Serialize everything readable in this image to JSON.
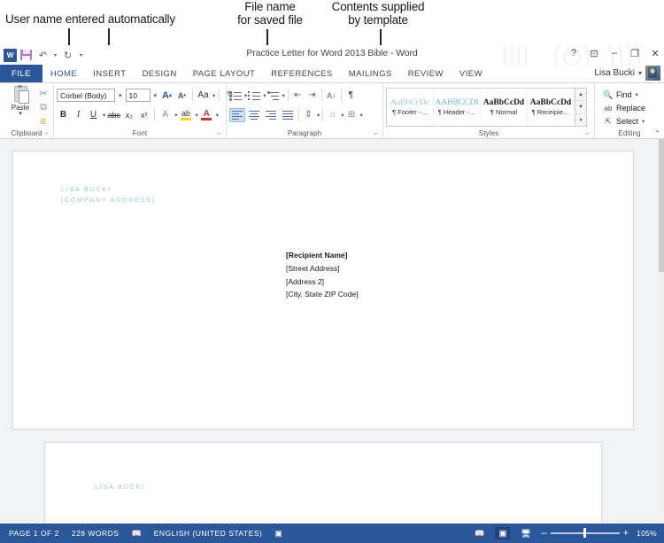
{
  "annotations": [
    {
      "id": "username",
      "text": "User name entered automatically"
    },
    {
      "id": "filename",
      "text": "File name\nfor saved file"
    },
    {
      "id": "contents",
      "text": "Contents supplied\nby template"
    }
  ],
  "window": {
    "title": "Practice Letter for Word 2013 Bible  -  Word",
    "quick_access": [
      {
        "name": "word-logo",
        "label": "W"
      },
      {
        "name": "save",
        "label": ""
      },
      {
        "name": "undo",
        "label": "↶"
      },
      {
        "name": "undo-dropdown",
        "label": "▾"
      },
      {
        "name": "redo",
        "label": "↻"
      },
      {
        "name": "customize-qat",
        "label": "▾"
      }
    ],
    "controls": [
      {
        "name": "help",
        "label": "?"
      },
      {
        "name": "ribbon-display-options",
        "label": "⊡"
      },
      {
        "name": "minimize",
        "label": "–"
      },
      {
        "name": "restore",
        "label": "❐"
      },
      {
        "name": "close",
        "label": "✕"
      }
    ],
    "account": {
      "name": "Lisa Bucki",
      "caret": "▾"
    }
  },
  "tabs": [
    {
      "label": "FILE",
      "state": "file"
    },
    {
      "label": "HOME",
      "state": "active"
    },
    {
      "label": "INSERT",
      "state": "normal"
    },
    {
      "label": "DESIGN",
      "state": "normal"
    },
    {
      "label": "PAGE LAYOUT",
      "state": "normal"
    },
    {
      "label": "REFERENCES",
      "state": "normal"
    },
    {
      "label": "MAILINGS",
      "state": "normal"
    },
    {
      "label": "REVIEW",
      "state": "normal"
    },
    {
      "label": "VIEW",
      "state": "normal"
    }
  ],
  "ribbon": {
    "collapse_label": "⌃",
    "clipboard": {
      "label": "Clipboard",
      "dialog_launcher": "⌐",
      "paste_label": "Paste",
      "paste_caret": "▾",
      "cut_label": "✂",
      "copy_label": "⧉",
      "format_painter_label": "⚟"
    },
    "font": {
      "label": "Font",
      "dialog_launcher": "⌐",
      "font_name": "Corbel (Body)",
      "font_size": "10",
      "grow_font": "A",
      "shrink_font": "A",
      "change_case": "Aa",
      "clear_formatting": "⌫",
      "bold": "B",
      "italic": "I",
      "underline": "U",
      "strikethrough": "abc",
      "subscript": "x₂",
      "superscript": "x²",
      "text_effects": "A",
      "highlight": "ab",
      "font_color": "A",
      "caret": "▾"
    },
    "paragraph": {
      "label": "Paragraph",
      "dialog_launcher": "⌐",
      "bullets": "bullets",
      "numbering": "numbering",
      "multilevel": "multilevel",
      "decrease_indent": "⇤",
      "increase_indent": "⇥",
      "sort": "↓",
      "show_marks": "¶",
      "align_left": "align-left",
      "align_center": "align-center",
      "align_right": "align-right",
      "justify": "justify",
      "line_spacing": "⇕",
      "shading": "▨",
      "borders": "⊞",
      "caret": "▾"
    },
    "styles": {
      "label": "Styles",
      "dialog_launcher": "⌐",
      "scroll_up": "▲",
      "scroll_down": "▼",
      "more": "▾",
      "items": [
        {
          "sample": "AaBbCcDc",
          "name": "¶ Footer -…",
          "color": "#9dc9e2",
          "bold": false
        },
        {
          "sample": "AABBCCDI",
          "name": "¶ Header -…",
          "color": "#73b4da",
          "bold": false
        },
        {
          "sample": "AaBbCcDd",
          "name": "¶ Normal",
          "color": "#1a1a1a",
          "bold": true
        },
        {
          "sample": "AaBbCcDd",
          "name": "¶ Receipie…",
          "color": "#1a1a1a",
          "bold": true
        }
      ]
    },
    "editing": {
      "label": "Editing",
      "find": "Find",
      "find_caret": "▾",
      "replace": "Replace",
      "select": "Select",
      "select_caret": "▾"
    }
  },
  "document": {
    "page1": {
      "sender_name": "LISA BUCKI",
      "sender_address": "[COMPANY ADDRESS]",
      "recipient": [
        "[Recipient Name]",
        "[Street Address]",
        "[Address 2]",
        "[City, State ZIP Code]"
      ]
    },
    "page2": {
      "sender_name": "LISA BUCKI"
    }
  },
  "statusbar": {
    "page_info": "PAGE 1 OF 2",
    "word_count": "228 WORDS",
    "proofing_icon": "proofing-errors-icon",
    "language": "ENGLISH (UNITED STATES)",
    "macro_icon": "macro-recording-icon",
    "views": [
      {
        "name": "read-mode",
        "icon": "📖",
        "selected": false
      },
      {
        "name": "print-layout",
        "icon": "▣",
        "selected": true
      },
      {
        "name": "web-layout",
        "icon": "🖥",
        "selected": false
      }
    ],
    "zoom_out": "–",
    "zoom_in": "+",
    "zoom_value": "105%"
  },
  "colors": {
    "word_blue": "#2b579a",
    "sender_blue": "#9dc9e2",
    "annotation_black": "#262626"
  }
}
